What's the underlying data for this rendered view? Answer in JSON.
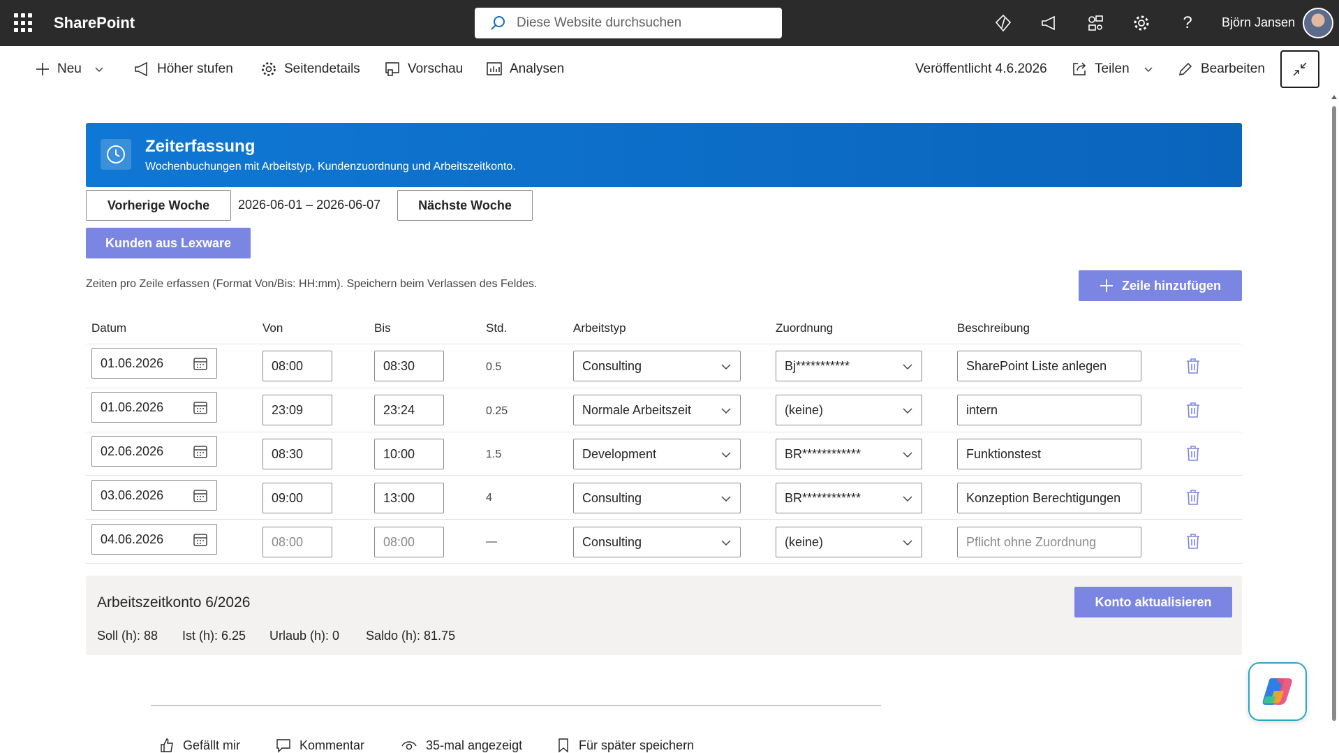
{
  "suite": {
    "brand": "SharePoint",
    "search_placeholder": "Diese Website durchsuchen",
    "user_name": "Björn Jansen"
  },
  "commands": {
    "new": "Neu",
    "promote": "Höher stufen",
    "page_details": "Seitendetails",
    "preview": "Vorschau",
    "analytics": "Analysen",
    "published": "Veröffentlicht 4.6.2026",
    "share": "Teilen",
    "edit": "Bearbeiten"
  },
  "banner": {
    "title": "Zeiterfassung",
    "subtitle": "Wochenbuchungen mit Arbeitstyp, Kundenzuordnung und Arbeitszeitkonto."
  },
  "week": {
    "prev_label": "Vorherige Woche",
    "range": "2026-06-01 – 2026-06-07",
    "next_label": "Nächste Woche"
  },
  "customers_button": "Kunden aus Lexware",
  "hint": "Zeiten pro Zeile erfassen (Format Von/Bis: HH:mm). Speichern beim Verlassen des Feldes.",
  "add_row_label": "Zeile hinzufügen",
  "columns": {
    "date": "Datum",
    "from": "Von",
    "to": "Bis",
    "hours": "Std.",
    "work_type": "Arbeitstyp",
    "assignment": "Zuordnung",
    "description": "Beschreibung"
  },
  "rows": [
    {
      "date": "01.06.2026",
      "from": "08:00",
      "to": "08:30",
      "hours": "0.5",
      "work_type": "Consulting",
      "assignment": "Bj***********",
      "description": "SharePoint Liste anlegen"
    },
    {
      "date": "01.06.2026",
      "from": "23:09",
      "to": "23:24",
      "hours": "0.25",
      "work_type": "Normale Arbeitszeit",
      "assignment": "(keine)",
      "description": "intern"
    },
    {
      "date": "02.06.2026",
      "from": "08:30",
      "to": "10:00",
      "hours": "1.5",
      "work_type": "Development",
      "assignment": "BR************",
      "description": "Funktionstest"
    },
    {
      "date": "03.06.2026",
      "from": "09:00",
      "to": "13:00",
      "hours": "4",
      "work_type": "Consulting",
      "assignment": "BR************",
      "description": "Konzeption Berechtigungen"
    },
    {
      "date": "04.06.2026",
      "from_placeholder": "08:00",
      "to_placeholder": "08:00",
      "hours": "—",
      "work_type": "Consulting",
      "assignment": "(keine)",
      "description_placeholder": "Pflicht ohne Zuordnung"
    }
  ],
  "account": {
    "title": "Arbeitszeitkonto 6/2026",
    "target": "Soll (h): 88",
    "actual": "Ist (h): 6.25",
    "vacation": "Urlaub (h): 0",
    "balance": "Saldo (h): 81.75",
    "update_label": "Konto aktualisieren"
  },
  "social": {
    "like": "Gefällt mir",
    "comment": "Kommentar",
    "views": "35-mal angezeigt",
    "save": "Für später speichern"
  },
  "colors": {
    "suitebar": "#2b2b2b",
    "banner": "#0f78d4",
    "primary_button": "#7b86e2",
    "trash_icon": "#7b86e2"
  }
}
